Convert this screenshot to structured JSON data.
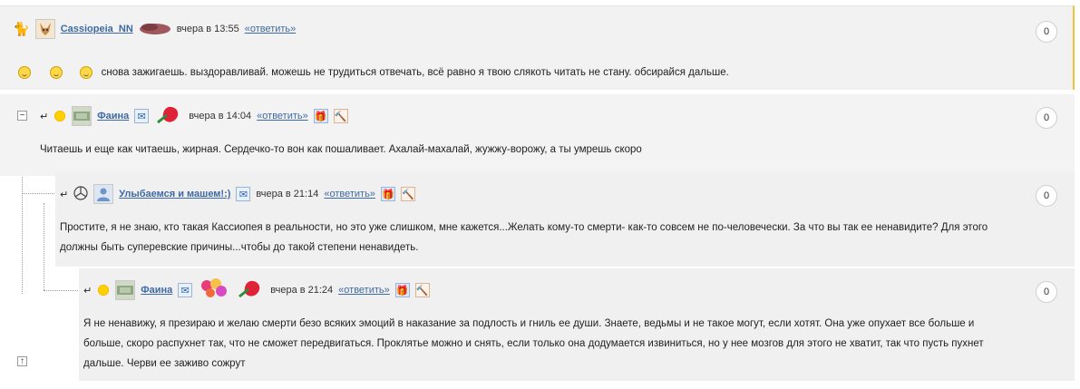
{
  "comments": [
    {
      "author": "Cassiopeia_NN",
      "time": "вчера в 13:55",
      "reply": "«ответить»",
      "count": "0",
      "text": "снова зажигаешь. выздоравливай. можешь не трудиться отвечать, всё равно я твою слякоть читать не стану. обсирайся дальше."
    },
    {
      "author": "Фаина",
      "time": "вчера в 14:04",
      "reply": "«ответить»",
      "count": "0",
      "text": "Читаешь и еще как читаешь, жирная. Сердечко-то вон как пошаливает. Ахалай-махалай, жужжу-ворожу, а ты умрешь скоро"
    },
    {
      "author": "Улыбаемся и машем!:)",
      "time": "вчера в 21:14",
      "reply": "«ответить»",
      "count": "0",
      "text_line1": "Простите, я не знаю, кто такая Кассиопея в реальности, но это уже слишком, мне кажется...Желать кому-то смерти- как-то совсем не по-человечески. За что вы так ее ненавидите? Для этого",
      "text_line2": "должны быть суперевские причины...чтобы до такой степени ненавидеть."
    },
    {
      "author": "Фаина",
      "time": "вчера в 21:24",
      "reply": "«ответить»",
      "count": "0",
      "text_line1": "Я не ненавижу, я презираю и желаю смерти безо всяких эмоций в наказание за подлость и гниль ее души. Знаете, ведьмы и не такое могут, если хотят. Она уже опухает все больше и",
      "text_line2": "больше, скоро распухнет так, что не сможет передвигаться. Проклятье можно и снять, если только она додумается извиниться, но у нее мозгов для этого не хватит, так что пусть пухнет",
      "text_line3": "дальше. Черви ее заживо сожрут"
    }
  ],
  "controls": {
    "collapse": "−",
    "scroll_up": "↑",
    "reply_arrow": "↵"
  },
  "colors": {
    "accent_border": "#f1c232",
    "link": "#3d6aa6"
  }
}
